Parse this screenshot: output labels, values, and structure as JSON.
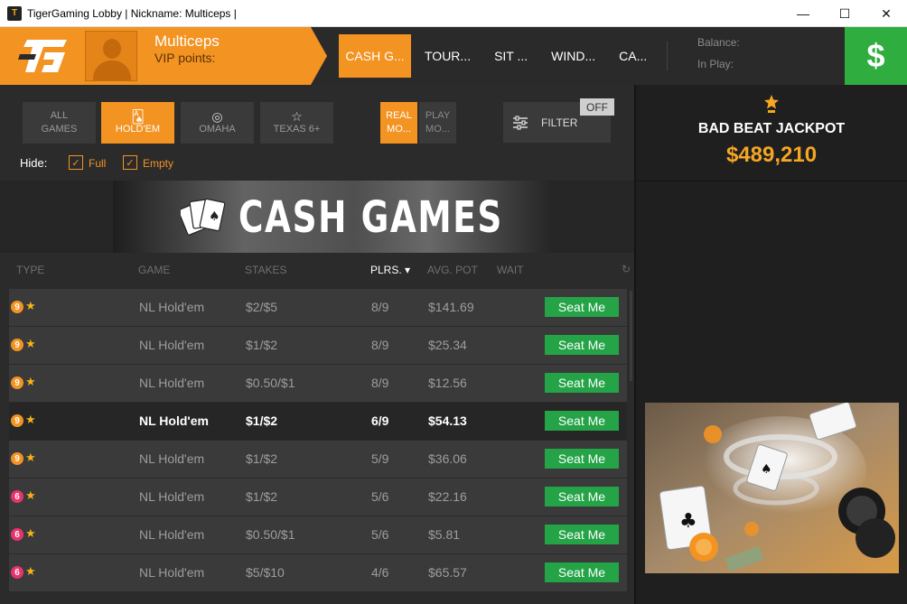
{
  "window": {
    "title": "TigerGaming Lobby | Nickname: Multiceps |",
    "minimize": "—",
    "maximize": "☐",
    "close": "✕"
  },
  "header": {
    "nickname": "Multiceps",
    "vip_label": "VIP points:",
    "nav_tabs": [
      "CASH G...",
      "TOUR...",
      "SIT ...",
      "WIND...",
      "CA..."
    ],
    "balance_label": "Balance:",
    "in_play_label": "In Play:",
    "cashier_symbol": "$"
  },
  "filters": {
    "games": [
      {
        "label1": "ALL",
        "label2": "GAMES"
      },
      {
        "label1": "HOLD'EM"
      },
      {
        "label1": "OMAHA"
      },
      {
        "label1": "TEXAS 6+"
      }
    ],
    "modes": [
      {
        "line1": "REAL",
        "line2": "MO..."
      },
      {
        "line1": "PLAY",
        "line2": "MO..."
      }
    ],
    "filter_label": "FILTER",
    "filter_state": "OFF",
    "hide_label": "Hide:",
    "hide_full": "Full",
    "hide_empty": "Empty"
  },
  "banner": {
    "title": "CASH GAMES"
  },
  "table": {
    "columns": [
      "TYPE",
      "GAME",
      "STAKES",
      "PLRS.",
      "AVG. POT",
      "WAIT"
    ],
    "sort_icon": "▾",
    "refresh_icon": "↻",
    "seat_label": "Seat Me",
    "rows": [
      {
        "type": "9",
        "game": "NL Hold'em",
        "stakes": "$2/$5",
        "players": "8/9",
        "avg_pot": "$141.69"
      },
      {
        "type": "9",
        "game": "NL Hold'em",
        "stakes": "$1/$2",
        "players": "8/9",
        "avg_pot": "$25.34"
      },
      {
        "type": "9",
        "game": "NL Hold'em",
        "stakes": "$0.50/$1",
        "players": "8/9",
        "avg_pot": "$12.56"
      },
      {
        "type": "9",
        "game": "NL Hold'em",
        "stakes": "$1/$2",
        "players": "6/9",
        "avg_pot": "$54.13"
      },
      {
        "type": "9",
        "game": "NL Hold'em",
        "stakes": "$1/$2",
        "players": "5/9",
        "avg_pot": "$36.06"
      },
      {
        "type": "6",
        "game": "NL Hold'em",
        "stakes": "$1/$2",
        "players": "5/6",
        "avg_pot": "$22.16"
      },
      {
        "type": "6",
        "game": "NL Hold'em",
        "stakes": "$0.50/$1",
        "players": "5/6",
        "avg_pot": "$5.81"
      },
      {
        "type": "6",
        "game": "NL Hold'em",
        "stakes": "$5/$10",
        "players": "4/6",
        "avg_pot": "$65.57"
      }
    ]
  },
  "jackpot": {
    "title": "BAD BEAT JACKPOT",
    "amount": "$489,210"
  },
  "colors": {
    "accent": "#f39322",
    "seat_green": "#24a347",
    "badge_9": "#f39322",
    "badge_6": "#e8336d",
    "jackpot_gold": "#f5a623"
  }
}
